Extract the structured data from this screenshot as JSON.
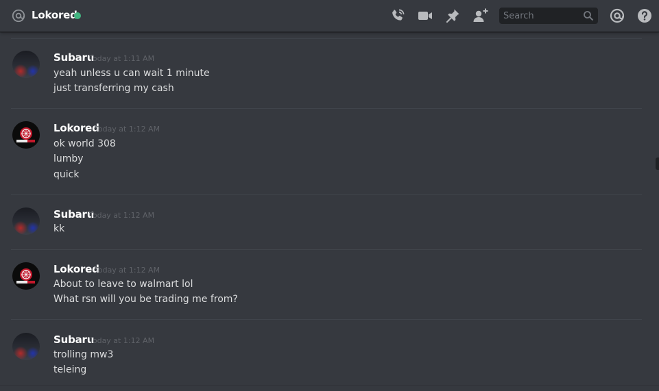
{
  "header": {
    "channel_name": "Lokored",
    "status_color": "#43b581",
    "search_placeholder": "Search",
    "icons": [
      "at-icon",
      "voice-call-icon",
      "video-call-icon",
      "pin-icon",
      "add-friend-icon",
      "search-icon",
      "mentions-icon",
      "help-icon"
    ]
  },
  "messages": [
    {
      "author": "Subaru",
      "timestamp": "Today at 1:11 AM",
      "lines": [
        "yeah unless u can wait 1 minute",
        "just transferring my cash"
      ]
    },
    {
      "author": "Lokored",
      "timestamp": "Today at 1:12 AM",
      "lines": [
        "ok world 308",
        "lumby",
        "quick"
      ]
    },
    {
      "author": "Subaru",
      "timestamp": "Today at 1:12 AM",
      "lines": [
        "kk"
      ]
    },
    {
      "author": "Lokored",
      "timestamp": "Today at 1:12 AM",
      "lines": [
        "About to leave to walmart lol",
        "What rsn will you be trading me from?"
      ]
    },
    {
      "author": "Subaru",
      "timestamp": "Today at 1:12 AM",
      "lines": [
        "trolling mw3",
        "teleing"
      ]
    }
  ],
  "colors": {
    "background": "#36393f",
    "username": "#ffffff",
    "text": "#dcddde",
    "timestamp": "#5f6268",
    "online": "#43b581"
  }
}
